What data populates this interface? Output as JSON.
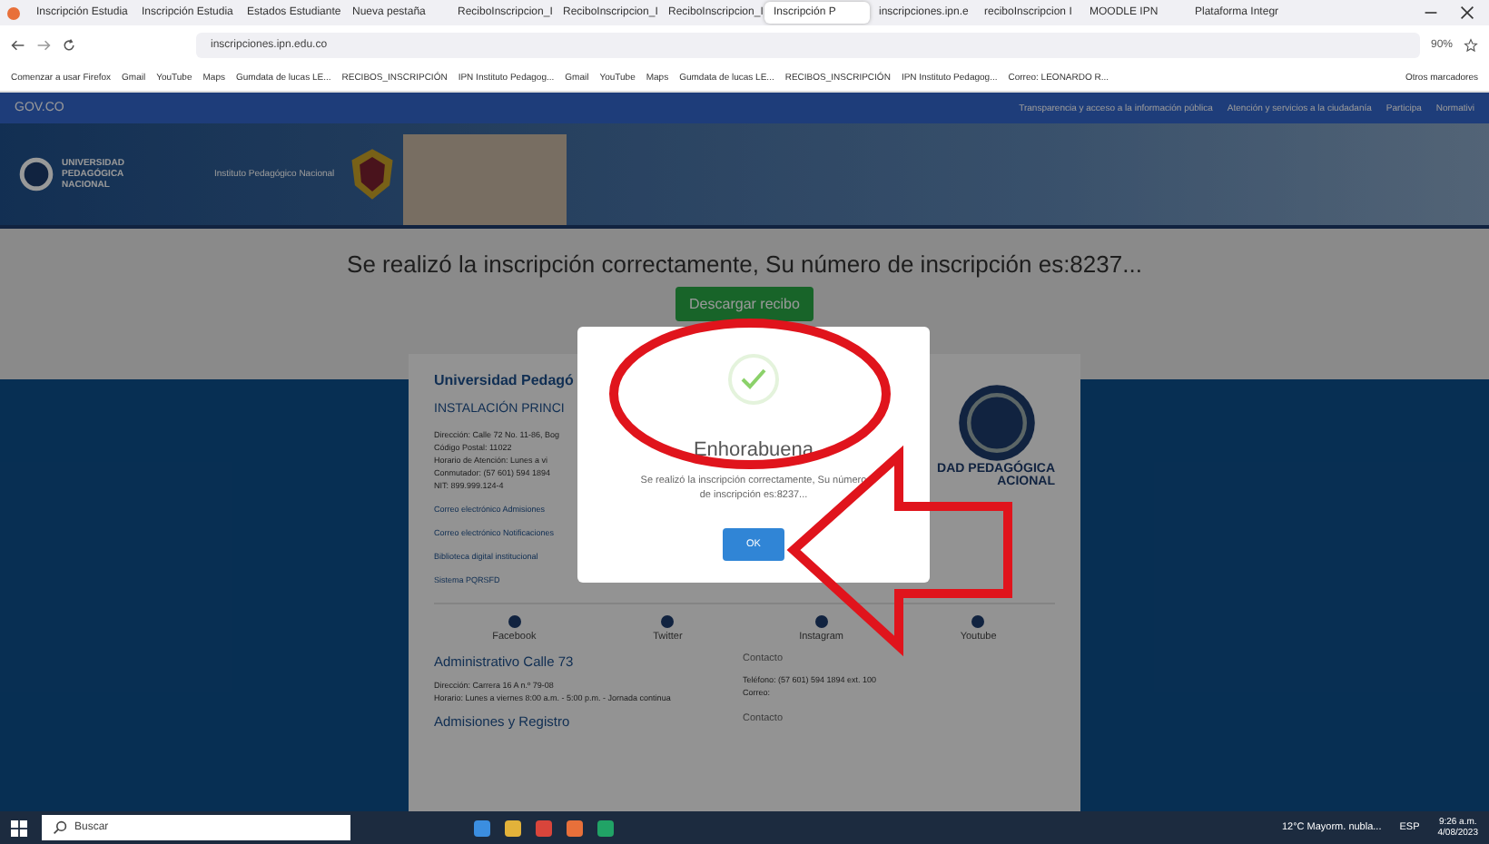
{
  "browser": {
    "tabs": [
      {
        "label": "Inscripción Estudia",
        "selected": false
      },
      {
        "label": "Inscripción Estudia",
        "selected": false
      },
      {
        "label": "Estados Estudiante",
        "selected": false
      },
      {
        "label": "Nueva pestaña",
        "selected": false
      },
      {
        "label": "ReciboInscripcion_I",
        "selected": false
      },
      {
        "label": "ReciboInscripcion_I",
        "selected": false
      },
      {
        "label": "ReciboInscripcion_I",
        "selected": false
      },
      {
        "label": "Inscripción P",
        "selected": true
      },
      {
        "label": "inscripciones.ipn.e",
        "selected": false
      },
      {
        "label": "reciboInscripcion I",
        "selected": false
      },
      {
        "label": "MOODLE IPN",
        "selected": false
      },
      {
        "label": "Plataforma Integr",
        "selected": false
      }
    ],
    "address": "inscripciones.ipn.edu.co",
    "zoom": "90%",
    "bookmarks": [
      "Comenzar a usar Firefox",
      "Gmail",
      "YouTube",
      "Maps",
      "Gumdata de lucas LE...",
      "RECIBOS_INSCRIPCIÓN",
      "IPN Instituto Pedagog...",
      "Gmail",
      "YouTube",
      "Maps",
      "Gumdata de lucas LE...",
      "RECIBOS_INSCRIPCIÓN",
      "IPN Instituto Pedagog...",
      "Correo: LEONARDO R..."
    ],
    "other_bookmarks": "Otros marcadores"
  },
  "gov_bar": {
    "brand": "GOV.CO",
    "links": [
      "Transparencia y acceso a la información pública",
      "Atención y servicios a la ciudadanía",
      "Participa",
      "Normativi"
    ]
  },
  "header": {
    "university": "UNIVERSIDAD PEDAGÓGICA NACIONAL",
    "institute": "Instituto Pedagógico Nacional"
  },
  "message": "Se realizó la inscripción correctamente, Su número de inscripción es:8237...",
  "download_button": "Descargar recibo",
  "card": {
    "title": "Universidad Pedagó",
    "subtitle": "INSTALACIÓN PRINCI",
    "lines": [
      "Dirección: Calle 72 No. 11-86, Bog",
      "Código Postal: 11022",
      "Horario de Atención: Lunes a vi",
      "Conmutador: (57 601) 594 1894",
      "NIT: 899.999.124-4"
    ],
    "links": [
      "Correo electrónico Admisiones",
      "Correo electrónico Notificaciones",
      "Biblioteca digital institucional",
      "Sistema PQRSFD"
    ],
    "logo_text": [
      "DAD PEDAGÓGICA",
      "ACIONAL"
    ],
    "social": [
      "Facebook",
      "Twitter",
      "Instagram",
      "Youtube"
    ],
    "sections": [
      {
        "title": "Administrativo Calle 73",
        "contact": "Contacto",
        "lines": [
          "Dirección: Carrera 16 A n.º 79-08",
          "Horario: Lunes a viernes 8:00 a.m. - 5:00 p.m. - Jornada continua"
        ],
        "contact_lines": [
          "Teléfono: (57 601) 594 1894 ext. 100",
          "Correo:"
        ]
      },
      {
        "title": "Admisiones y Registro",
        "contact": "Contacto"
      }
    ]
  },
  "modal": {
    "title": "Enhorabuena",
    "text": "Se realizó la inscripción correctamente, Su número de inscripción es:8237...",
    "ok": "OK"
  },
  "taskbar": {
    "search": "Buscar",
    "weather": "12°C Mayorm. nubla...",
    "language": "ESP",
    "time": "9:26 a.m.",
    "date": "4/08/2023"
  }
}
